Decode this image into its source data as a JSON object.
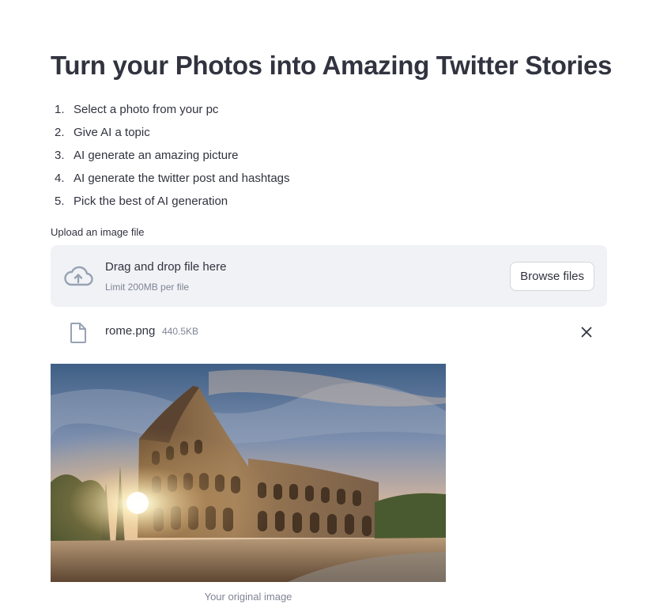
{
  "page": {
    "title": "Turn your Photos into Amazing Twitter Stories"
  },
  "steps": [
    {
      "num": "1.",
      "text": "Select a photo from your pc"
    },
    {
      "num": "2.",
      "text": "Give AI a topic"
    },
    {
      "num": "3.",
      "text": "AI generate an amazing picture"
    },
    {
      "num": "4.",
      "text": "AI generate the twitter post and hashtags"
    },
    {
      "num": "5.",
      "text": "Pick the best of AI generation"
    }
  ],
  "uploader": {
    "label": "Upload an image file",
    "drop_text": "Drag and drop file here",
    "limit_text": "Limit 200MB per file",
    "browse_label": "Browse files",
    "icon": "cloud-upload-icon"
  },
  "uploaded_file": {
    "name": "rome.png",
    "size": "440.5KB",
    "icon": "file-icon",
    "remove_icon": "close-icon"
  },
  "image": {
    "caption": "Your original image"
  },
  "colors": {
    "text": "#31333f",
    "muted": "#808495",
    "dropzone_bg": "#f0f2f6",
    "button_border": "#d5d6da"
  }
}
